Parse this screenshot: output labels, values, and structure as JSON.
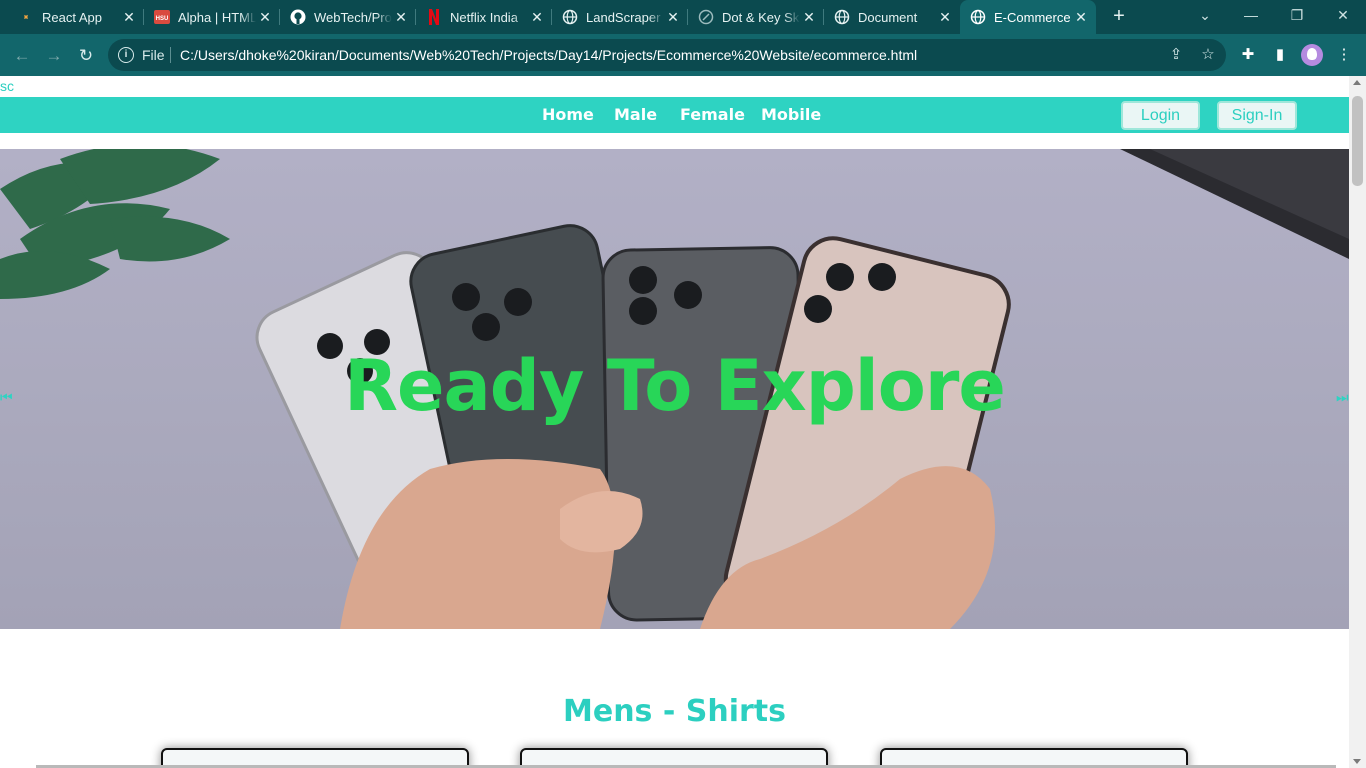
{
  "browser": {
    "tabs": [
      {
        "title": "React App",
        "icon": "react-icon",
        "active": false
      },
      {
        "title": "Alpha | HTML",
        "icon": "hsu-icon",
        "active": false
      },
      {
        "title": "WebTech/Projects",
        "icon": "github-icon",
        "active": false
      },
      {
        "title": "Netflix India",
        "icon": "netflix-icon",
        "active": false
      },
      {
        "title": "LandScraper",
        "icon": "globe-icon",
        "active": false
      },
      {
        "title": "Dot & Key Skin",
        "icon": "link-icon",
        "active": false
      },
      {
        "title": "Document",
        "icon": "globe-icon",
        "active": false
      },
      {
        "title": "E-Commerce",
        "icon": "globe-icon",
        "active": true
      }
    ],
    "address": {
      "scheme_label": "File",
      "url": "C:/Users/dhoke%20kiran/Documents/Web%20Tech/Projects/Day14/Projects/Ecommerce%20Website/ecommerce.html"
    },
    "colors": {
      "tabbar": "#0b4a4f",
      "toolbar": "#12666b"
    }
  },
  "page": {
    "top_text": "sc",
    "nav": {
      "links": [
        "Home",
        "Male",
        "Female",
        "Mobile"
      ],
      "login_label": "Login",
      "signin_label": "Sign-In"
    },
    "hero": {
      "title": "Ready To Explore",
      "prev_icon": "chevron-left-icon",
      "next_icon": "chevron-right-icon"
    },
    "section_title": "Mens - Shirts",
    "colors": {
      "accent": "#2ed3c2",
      "hero_text": "#28d658"
    }
  }
}
